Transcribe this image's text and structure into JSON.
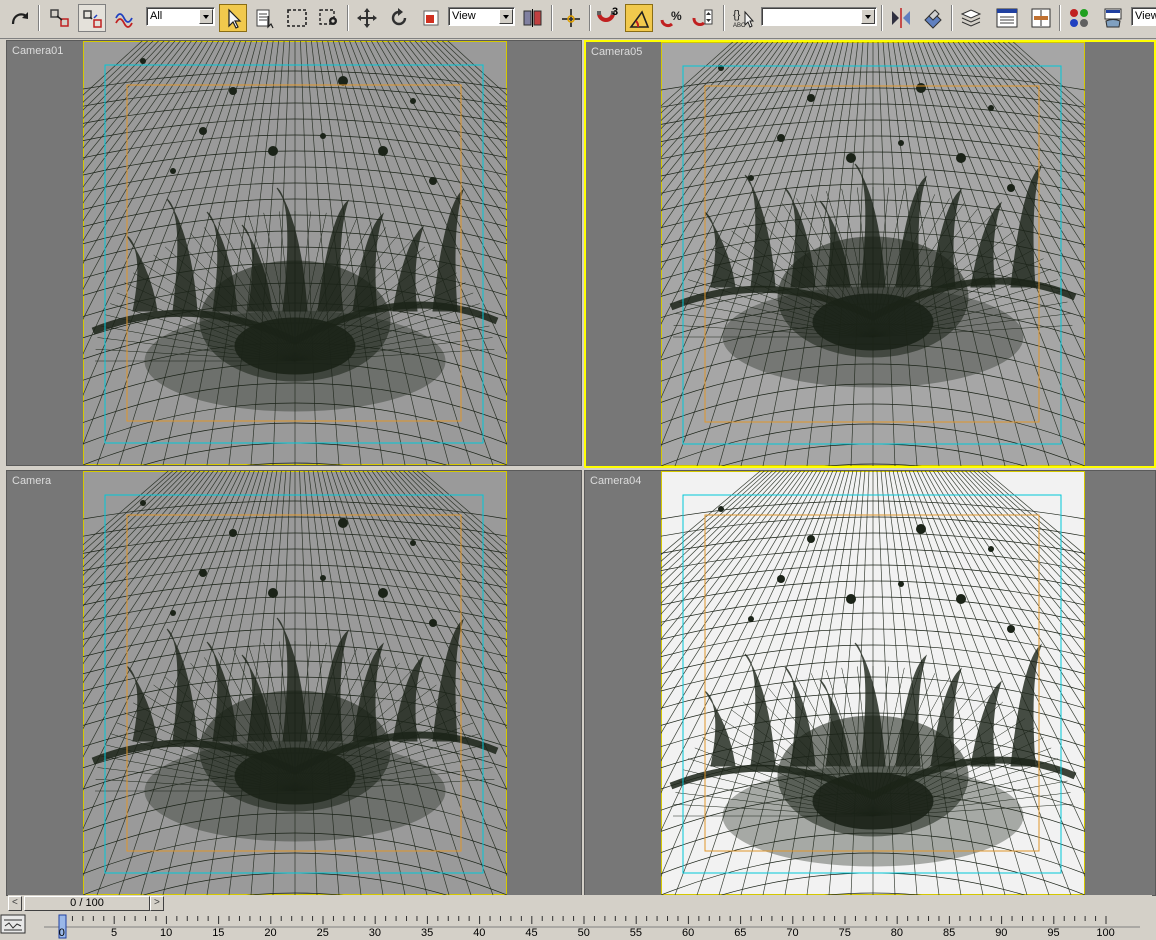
{
  "toolbar": {
    "selection_filter": "All",
    "ref_coord_left": "View",
    "ref_coord_right": "View",
    "snap_number": "3",
    "named_selection": "",
    "items": [
      {
        "name": "redo-icon",
        "interactable": true
      },
      {
        "name": "select-and-link-icon",
        "interactable": true
      },
      {
        "name": "unlink-selection-icon",
        "interactable": true
      },
      {
        "name": "bind-to-space-warp-icon",
        "interactable": true
      },
      {
        "name": "select-object-icon",
        "interactable": true
      },
      {
        "name": "select-by-name-icon",
        "interactable": true
      },
      {
        "name": "rectangular-selection-icon",
        "interactable": true
      },
      {
        "name": "window-crossing-icon",
        "interactable": true
      },
      {
        "name": "select-and-move-icon",
        "interactable": true
      },
      {
        "name": "select-and-rotate-icon",
        "interactable": true
      },
      {
        "name": "select-and-scale-icon",
        "interactable": true
      },
      {
        "name": "use-pivot-center-icon",
        "interactable": true
      },
      {
        "name": "manipulate-icon",
        "interactable": true
      },
      {
        "name": "snaps-toggle-icon",
        "interactable": true
      },
      {
        "name": "angle-snap-icon",
        "interactable": true
      },
      {
        "name": "percent-snap-icon",
        "interactable": true
      },
      {
        "name": "spinner-snap-icon",
        "interactable": true
      },
      {
        "name": "edit-named-selection-icon",
        "interactable": true
      },
      {
        "name": "mirror-icon",
        "interactable": true
      },
      {
        "name": "align-icon",
        "interactable": true
      },
      {
        "name": "layer-manager-icon",
        "interactable": true
      },
      {
        "name": "curve-editor-icon",
        "interactable": true
      },
      {
        "name": "schematic-view-icon",
        "interactable": true
      },
      {
        "name": "material-editor-icon",
        "interactable": true
      },
      {
        "name": "render-setup-icon",
        "interactable": true
      }
    ]
  },
  "viewports": [
    {
      "label": "Camera01",
      "bg": "#9a9a9a",
      "active": false
    },
    {
      "label": "Camera05",
      "bg": "#a6a6a6",
      "active": true
    },
    {
      "label": "Camera",
      "bg": "#9a9a9a",
      "active": false
    },
    {
      "label": "Camera04",
      "bg": "#f2f2f2",
      "active": false
    }
  ],
  "colors": {
    "active_border": "#ffff00",
    "safe_frame_outer": "#00c8d8",
    "safe_frame_inner": "#e0962a",
    "frame_border": "#d4c800",
    "mesh": "#1b2318"
  },
  "time_slider": {
    "label": "0 / 100",
    "prev": "<",
    "next": ">"
  },
  "trackbar": {
    "labels": [
      "0",
      "5",
      "10",
      "15",
      "20",
      "25",
      "30",
      "35",
      "40",
      "45",
      "50",
      "55",
      "60",
      "65",
      "70",
      "75",
      "80",
      "85",
      "90",
      "95",
      "100"
    ]
  }
}
